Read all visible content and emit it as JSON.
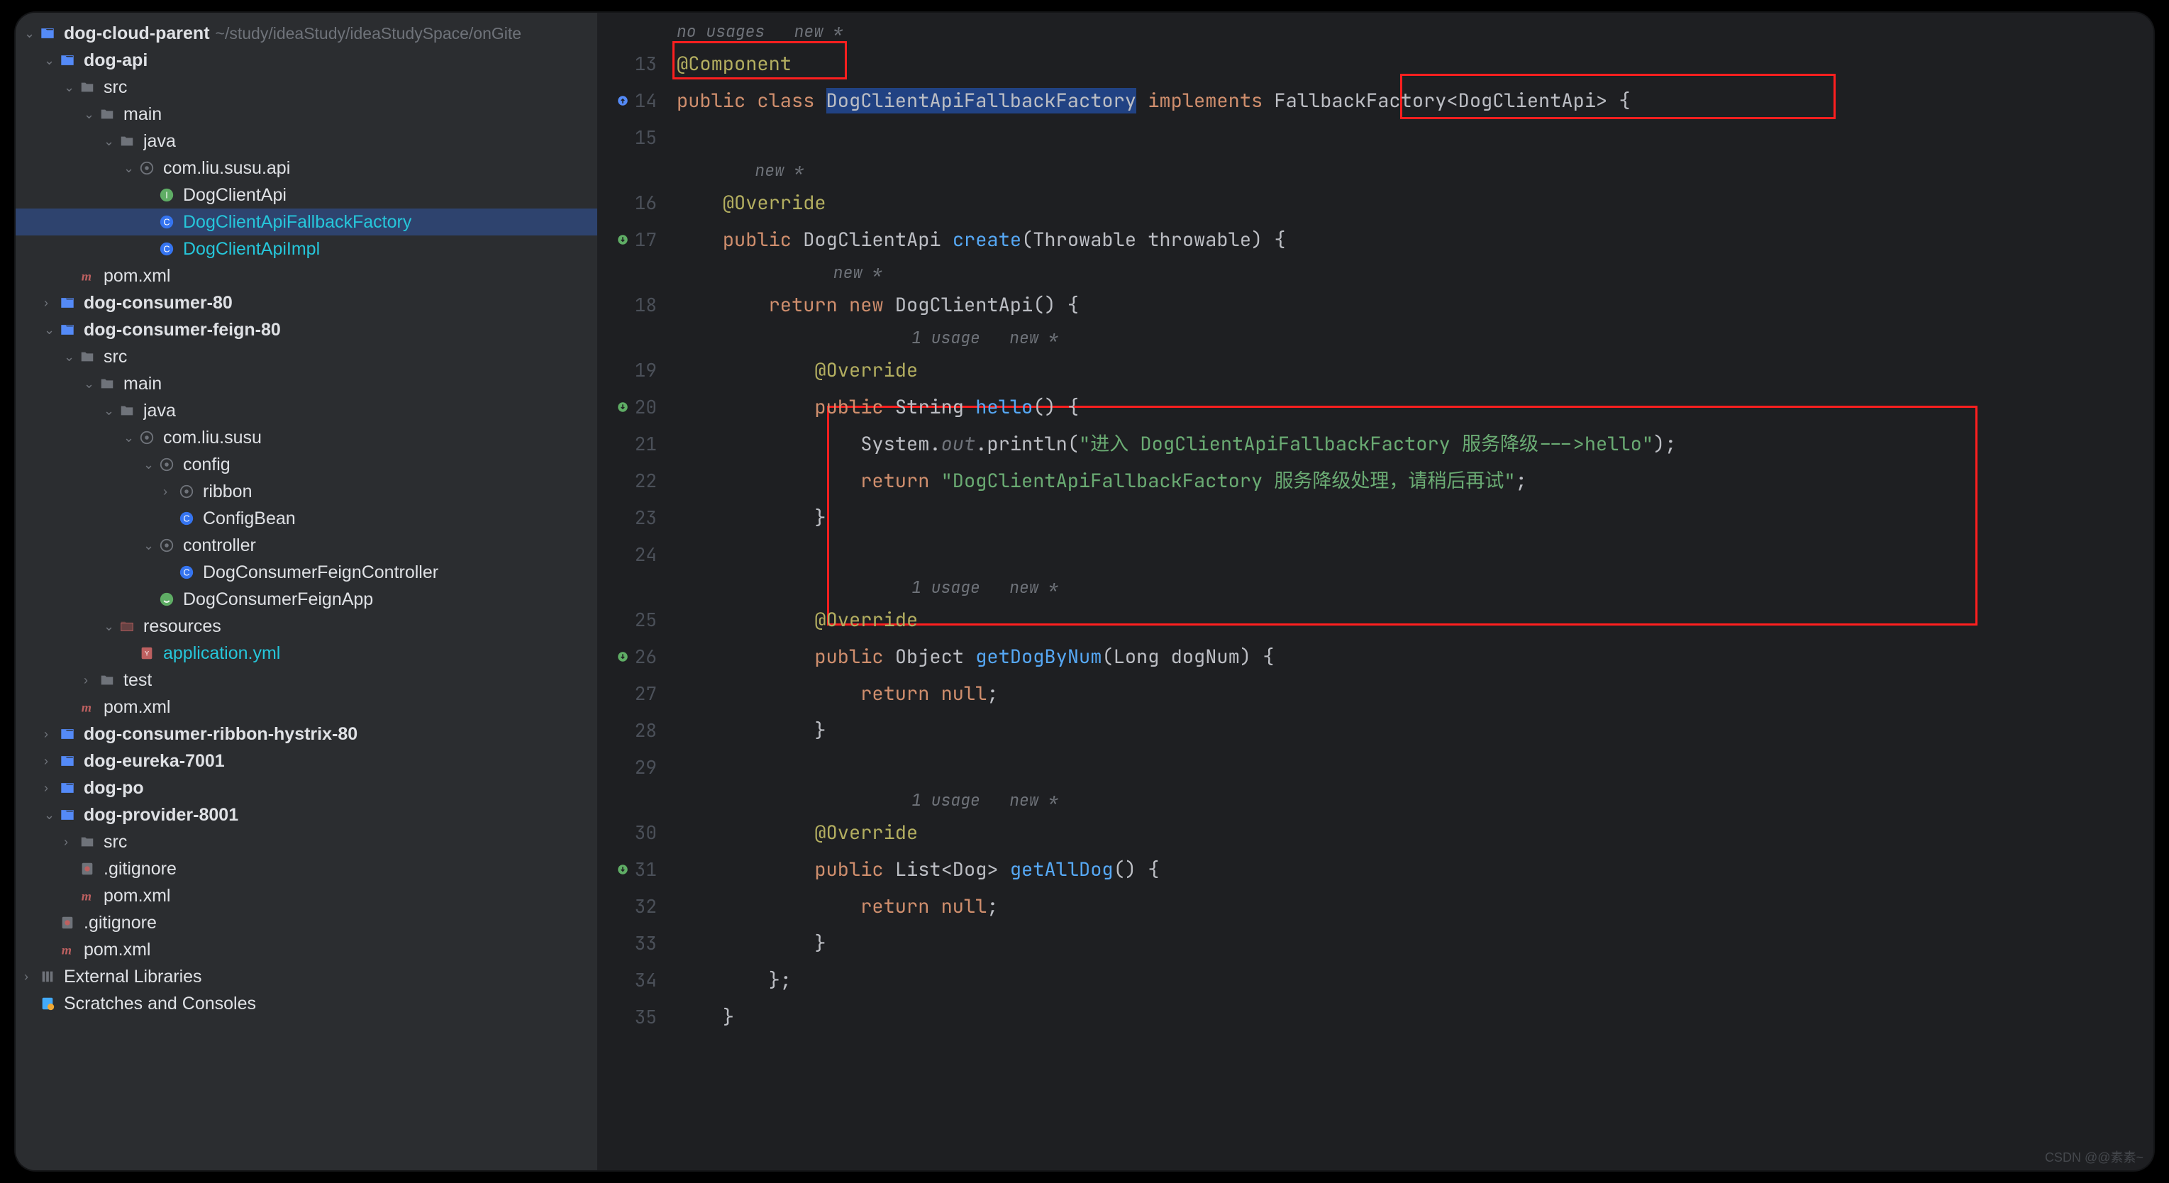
{
  "sidebar": {
    "project": {
      "name": "dog-cloud-parent",
      "path": "~/study/ideaStudy/ideaStudySpace/onGite"
    },
    "nodes": [
      {
        "depth": 0,
        "chev": "down",
        "icon": "module",
        "label": "dog-cloud-parent",
        "bold": true,
        "pathSuffix": "~/study/ideaStudy/ideaStudySpace/onGite"
      },
      {
        "depth": 1,
        "chev": "down",
        "icon": "module",
        "label": "dog-api",
        "bold": true
      },
      {
        "depth": 2,
        "chev": "down",
        "icon": "folder",
        "label": "src"
      },
      {
        "depth": 3,
        "chev": "down",
        "icon": "folder",
        "label": "main"
      },
      {
        "depth": 4,
        "chev": "down",
        "icon": "folder",
        "label": "java"
      },
      {
        "depth": 5,
        "chev": "down",
        "icon": "package",
        "label": "com.liu.susu.api"
      },
      {
        "depth": 6,
        "chev": "",
        "icon": "interface",
        "label": "DogClientApi"
      },
      {
        "depth": 6,
        "chev": "",
        "icon": "class",
        "label": "DogClientApiFallbackFactory",
        "selected": true,
        "teal": true
      },
      {
        "depth": 6,
        "chev": "",
        "icon": "class",
        "label": "DogClientApiImpl",
        "teal": true
      },
      {
        "depth": 2,
        "chev": "",
        "icon": "maven",
        "label": "pom.xml"
      },
      {
        "depth": 1,
        "chev": "right",
        "icon": "module",
        "label": "dog-consumer-80",
        "bold": true
      },
      {
        "depth": 1,
        "chev": "down",
        "icon": "module",
        "label": "dog-consumer-feign-80",
        "bold": true
      },
      {
        "depth": 2,
        "chev": "down",
        "icon": "folder",
        "label": "src"
      },
      {
        "depth": 3,
        "chev": "down",
        "icon": "folder",
        "label": "main"
      },
      {
        "depth": 4,
        "chev": "down",
        "icon": "folder",
        "label": "java"
      },
      {
        "depth": 5,
        "chev": "down",
        "icon": "package",
        "label": "com.liu.susu"
      },
      {
        "depth": 6,
        "chev": "down",
        "icon": "package",
        "label": "config"
      },
      {
        "depth": 7,
        "chev": "right",
        "icon": "package",
        "label": "ribbon"
      },
      {
        "depth": 7,
        "chev": "",
        "icon": "class",
        "label": "ConfigBean"
      },
      {
        "depth": 6,
        "chev": "down",
        "icon": "package",
        "label": "controller"
      },
      {
        "depth": 7,
        "chev": "",
        "icon": "class",
        "label": "DogConsumerFeignController"
      },
      {
        "depth": 6,
        "chev": "",
        "icon": "spring",
        "label": "DogConsumerFeignApp"
      },
      {
        "depth": 4,
        "chev": "down",
        "icon": "resources",
        "label": "resources"
      },
      {
        "depth": 5,
        "chev": "",
        "icon": "yaml",
        "label": "application.yml",
        "teal": true
      },
      {
        "depth": 3,
        "chev": "right",
        "icon": "folder",
        "label": "test"
      },
      {
        "depth": 2,
        "chev": "",
        "icon": "maven",
        "label": "pom.xml"
      },
      {
        "depth": 1,
        "chev": "right",
        "icon": "module",
        "label": "dog-consumer-ribbon-hystrix-80",
        "bold": true
      },
      {
        "depth": 1,
        "chev": "right",
        "icon": "module",
        "label": "dog-eureka-7001",
        "bold": true
      },
      {
        "depth": 1,
        "chev": "right",
        "icon": "module",
        "label": "dog-po",
        "bold": true
      },
      {
        "depth": 1,
        "chev": "down",
        "icon": "module",
        "label": "dog-provider-8001",
        "bold": true
      },
      {
        "depth": 2,
        "chev": "right",
        "icon": "folder",
        "label": "src"
      },
      {
        "depth": 2,
        "chev": "",
        "icon": "gitignore",
        "label": ".gitignore"
      },
      {
        "depth": 2,
        "chev": "",
        "icon": "maven",
        "label": "pom.xml"
      },
      {
        "depth": 1,
        "chev": "",
        "icon": "gitignore",
        "label": ".gitignore"
      },
      {
        "depth": 1,
        "chev": "",
        "icon": "maven",
        "label": "pom.xml"
      },
      {
        "depth": 0,
        "chev": "right",
        "icon": "library",
        "label": "External Libraries"
      },
      {
        "depth": 0,
        "chev": "",
        "icon": "scratch",
        "label": "Scratches and Consoles"
      }
    ]
  },
  "editor": {
    "lines": [
      {
        "type": "inlay",
        "text": "no usages   new *",
        "indent": 0
      },
      {
        "type": "code",
        "num": 13,
        "html": "<span class='anno'>@Component</span>",
        "bulb": true
      },
      {
        "type": "code",
        "num": 14,
        "html": "<span class='kw'>public class </span><span class='typ sel'>DogClientApiFallbackFactory</span><span class='typ'> </span><span class='kw'>implements</span><span class='typ'> FallbackFactory&lt;DogClientApi&gt; {</span>",
        "mark": "impl"
      },
      {
        "type": "code",
        "num": 15,
        "html": ""
      },
      {
        "type": "inlay",
        "text": "new *",
        "indent": 2
      },
      {
        "type": "code",
        "num": 16,
        "html": "    <span class='anno'>@Override</span>"
      },
      {
        "type": "code",
        "num": 17,
        "html": "    <span class='kw'>public</span> <span class='typ'>DogClientApi</span> <span class='fn'>create</span><span class='typ'>(Throwable throwable) {</span>",
        "mark": "override"
      },
      {
        "type": "inlay",
        "text": "new *",
        "indent": 4
      },
      {
        "type": "code",
        "num": 18,
        "html": "        <span class='kw'>return new</span> <span class='typ'>DogClientApi() {</span>"
      },
      {
        "type": "inlay",
        "text": "1 usage   new *",
        "indent": 6
      },
      {
        "type": "code",
        "num": 19,
        "html": "            <span class='anno'>@Override</span>"
      },
      {
        "type": "code",
        "num": 20,
        "html": "            <span class='kw'>public</span> <span class='typ'>String</span> <span class='fn'>hello</span><span class='typ'>() {</span>",
        "mark": "override"
      },
      {
        "type": "code",
        "num": 21,
        "html": "                <span class='typ'>System.</span><span class='id dim'>out</span><span class='typ'>.println(</span><span class='str'>\"进入 DogClientApiFallbackFactory 服务降级---&gt;hello\"</span><span class='typ'>);</span>"
      },
      {
        "type": "code",
        "num": 22,
        "html": "                <span class='kw'>return</span> <span class='str'>\"DogClientApiFallbackFactory 服务降级处理，请稍后再试\"</span><span class='typ'>;</span>"
      },
      {
        "type": "code",
        "num": 23,
        "html": "            <span class='typ'>}</span>"
      },
      {
        "type": "code",
        "num": 24,
        "html": ""
      },
      {
        "type": "inlay",
        "text": "1 usage   new *",
        "indent": 6
      },
      {
        "type": "code",
        "num": 25,
        "html": "            <span class='anno'>@Override</span>"
      },
      {
        "type": "code",
        "num": 26,
        "html": "            <span class='kw'>public</span> <span class='typ'>Object</span> <span class='fn'>getDogByNum</span><span class='typ'>(Long dogNum) {</span>",
        "mark": "override"
      },
      {
        "type": "code",
        "num": 27,
        "html": "                <span class='kw'>return null</span><span class='typ'>;</span>"
      },
      {
        "type": "code",
        "num": 28,
        "html": "            <span class='typ'>}</span>"
      },
      {
        "type": "code",
        "num": 29,
        "html": ""
      },
      {
        "type": "inlay",
        "text": "1 usage   new *",
        "indent": 6
      },
      {
        "type": "code",
        "num": 30,
        "html": "            <span class='anno'>@Override</span>"
      },
      {
        "type": "code",
        "num": 31,
        "html": "            <span class='kw'>public</span> <span class='typ'>List&lt;Dog&gt;</span> <span class='fn'>getAllDog</span><span class='typ'>() {</span>",
        "mark": "override"
      },
      {
        "type": "code",
        "num": 32,
        "html": "                <span class='kw'>return null</span><span class='typ'>;</span>"
      },
      {
        "type": "code",
        "num": 33,
        "html": "            <span class='typ'>}</span>"
      },
      {
        "type": "code",
        "num": 34,
        "html": "        <span class='typ'>};</span>"
      },
      {
        "type": "code",
        "num": 35,
        "html": "    <span class='typ'>}</span>"
      }
    ]
  },
  "watermark": "CSDN @@素素~"
}
